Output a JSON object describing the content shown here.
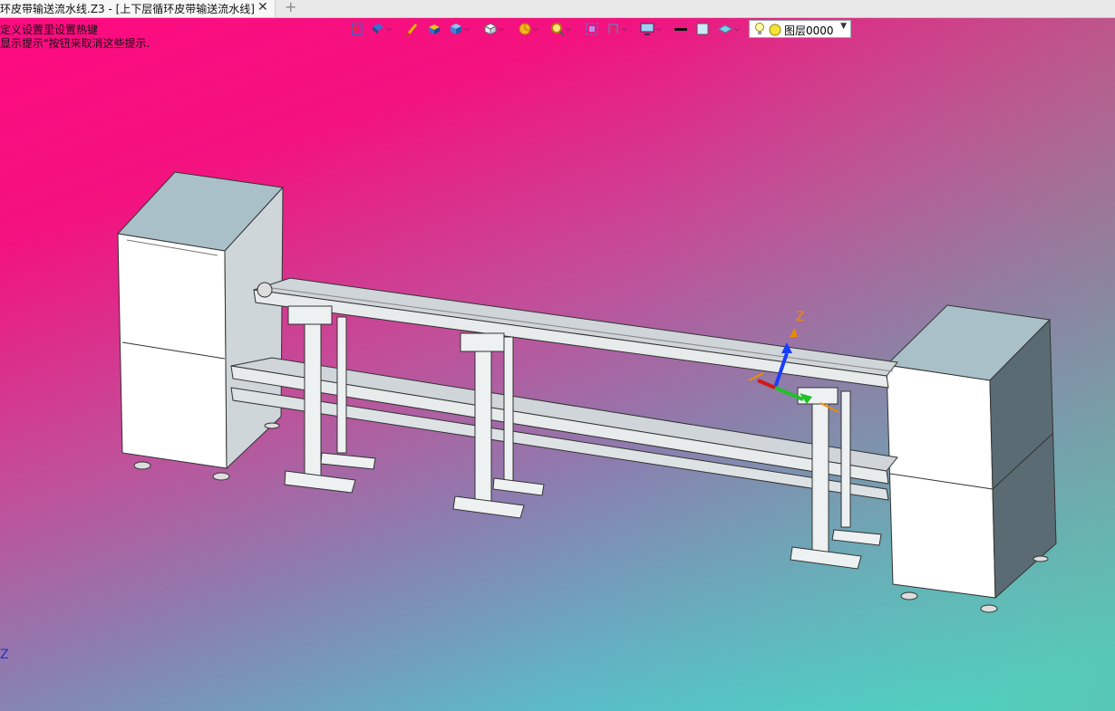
{
  "tab": {
    "title": "环皮带输送流水线.Z3 - [上下层循环皮带输送流水线]",
    "close": "✕",
    "add": "+"
  },
  "hints": {
    "line1": "定义设置里设置热键",
    "line2": "显示提示\"按钮来取消这些提示."
  },
  "toolbar": {
    "icons": [
      "exit-sketch-icon",
      "view-mode-icon",
      "brush-icon",
      "shaded-box-icon",
      "cube-render-icon",
      "white-cube-icon",
      "filter-icon",
      "zoom-icon",
      "fit-view-icon",
      "section-view-icon",
      "display-icon",
      "line-color-icon",
      "face-color-icon",
      "layer-style-icon"
    ]
  },
  "layer": {
    "label": "图层0000"
  },
  "triad": {
    "z_label": "Z"
  },
  "corner_axis_label": "Z"
}
